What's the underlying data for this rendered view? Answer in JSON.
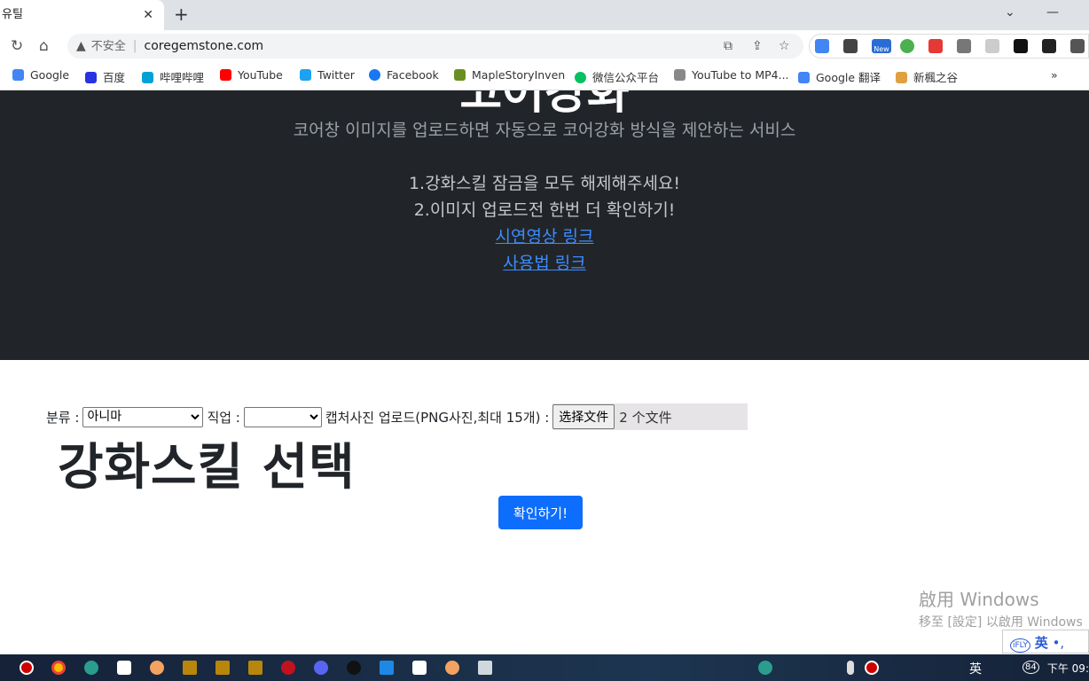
{
  "browser": {
    "tab_title": "유틸",
    "new_tab": "+",
    "security_label": "不安全",
    "url": "coregemstone.com",
    "bookmarks": [
      {
        "label": "Google",
        "color": "#4285f4"
      },
      {
        "label": "百度",
        "color": "#2932e1"
      },
      {
        "label": "哔哩哔哩",
        "color": "#00a1d6"
      },
      {
        "label": "YouTube",
        "color": "#ff0000"
      },
      {
        "label": "Twitter",
        "color": "#1da1f2"
      },
      {
        "label": "Facebook",
        "color": "#1877f2"
      },
      {
        "label": "MapleStoryInven",
        "color": "#6b8e23"
      },
      {
        "label": "微信公众平台",
        "color": "#07c160"
      },
      {
        "label": "YouTube to MP4...",
        "color": "#888888"
      },
      {
        "label": "Google 翻译",
        "color": "#4285f4"
      },
      {
        "label": "新楓之谷",
        "color": "#e0a040"
      }
    ],
    "more": "»",
    "extension_badge": "New"
  },
  "hero": {
    "title": "코어강화",
    "subtitle": "코어창 이미지를 업로드하면 자동으로 코어강화 방식을 제안하는 서비스",
    "line1": "1.강화스킬 잠금을 모두 해제해주세요!",
    "line2": "2.이미지 업로드전 한번 더 확인하기!",
    "link1": "시연영상 링크",
    "link2": "사용법 링크"
  },
  "form": {
    "category_label": "분류 :",
    "category_value": "아니마",
    "job_label": "직업 :",
    "job_value": "",
    "upload_label": "캡처사진 업로드(PNG사진,최대 15개) :",
    "file_button": "选择文件",
    "file_status": "2 个文件"
  },
  "section_title": "강화스킬 선택",
  "confirm_button": "확인하기!",
  "watermark": {
    "line1": "啟用 Windows",
    "line2": "移至 [設定] 以啟用 Windows"
  },
  "ime": {
    "brand": "iFLY",
    "mode": "英"
  },
  "taskbar": {
    "clock": "下午 09:",
    "battery": "84",
    "lang": "英"
  },
  "colors": {
    "hero_bg": "#212529",
    "accent": "#0d6efd",
    "link": "#3d8bfd"
  }
}
